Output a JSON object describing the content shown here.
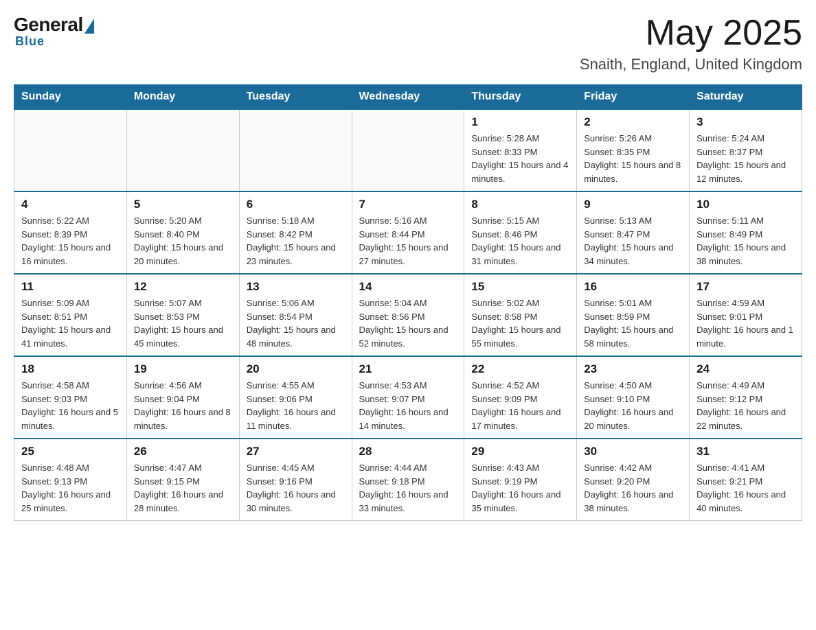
{
  "header": {
    "logo": {
      "general": "General",
      "blue": "Blue"
    },
    "title": "May 2025",
    "subtitle": "Snaith, England, United Kingdom"
  },
  "calendar": {
    "days_of_week": [
      "Sunday",
      "Monday",
      "Tuesday",
      "Wednesday",
      "Thursday",
      "Friday",
      "Saturday"
    ],
    "weeks": [
      [
        {
          "day": "",
          "info": ""
        },
        {
          "day": "",
          "info": ""
        },
        {
          "day": "",
          "info": ""
        },
        {
          "day": "",
          "info": ""
        },
        {
          "day": "1",
          "info": "Sunrise: 5:28 AM\nSunset: 8:33 PM\nDaylight: 15 hours and 4 minutes."
        },
        {
          "day": "2",
          "info": "Sunrise: 5:26 AM\nSunset: 8:35 PM\nDaylight: 15 hours and 8 minutes."
        },
        {
          "day": "3",
          "info": "Sunrise: 5:24 AM\nSunset: 8:37 PM\nDaylight: 15 hours and 12 minutes."
        }
      ],
      [
        {
          "day": "4",
          "info": "Sunrise: 5:22 AM\nSunset: 8:39 PM\nDaylight: 15 hours and 16 minutes."
        },
        {
          "day": "5",
          "info": "Sunrise: 5:20 AM\nSunset: 8:40 PM\nDaylight: 15 hours and 20 minutes."
        },
        {
          "day": "6",
          "info": "Sunrise: 5:18 AM\nSunset: 8:42 PM\nDaylight: 15 hours and 23 minutes."
        },
        {
          "day": "7",
          "info": "Sunrise: 5:16 AM\nSunset: 8:44 PM\nDaylight: 15 hours and 27 minutes."
        },
        {
          "day": "8",
          "info": "Sunrise: 5:15 AM\nSunset: 8:46 PM\nDaylight: 15 hours and 31 minutes."
        },
        {
          "day": "9",
          "info": "Sunrise: 5:13 AM\nSunset: 8:47 PM\nDaylight: 15 hours and 34 minutes."
        },
        {
          "day": "10",
          "info": "Sunrise: 5:11 AM\nSunset: 8:49 PM\nDaylight: 15 hours and 38 minutes."
        }
      ],
      [
        {
          "day": "11",
          "info": "Sunrise: 5:09 AM\nSunset: 8:51 PM\nDaylight: 15 hours and 41 minutes."
        },
        {
          "day": "12",
          "info": "Sunrise: 5:07 AM\nSunset: 8:53 PM\nDaylight: 15 hours and 45 minutes."
        },
        {
          "day": "13",
          "info": "Sunrise: 5:06 AM\nSunset: 8:54 PM\nDaylight: 15 hours and 48 minutes."
        },
        {
          "day": "14",
          "info": "Sunrise: 5:04 AM\nSunset: 8:56 PM\nDaylight: 15 hours and 52 minutes."
        },
        {
          "day": "15",
          "info": "Sunrise: 5:02 AM\nSunset: 8:58 PM\nDaylight: 15 hours and 55 minutes."
        },
        {
          "day": "16",
          "info": "Sunrise: 5:01 AM\nSunset: 8:59 PM\nDaylight: 15 hours and 58 minutes."
        },
        {
          "day": "17",
          "info": "Sunrise: 4:59 AM\nSunset: 9:01 PM\nDaylight: 16 hours and 1 minute."
        }
      ],
      [
        {
          "day": "18",
          "info": "Sunrise: 4:58 AM\nSunset: 9:03 PM\nDaylight: 16 hours and 5 minutes."
        },
        {
          "day": "19",
          "info": "Sunrise: 4:56 AM\nSunset: 9:04 PM\nDaylight: 16 hours and 8 minutes."
        },
        {
          "day": "20",
          "info": "Sunrise: 4:55 AM\nSunset: 9:06 PM\nDaylight: 16 hours and 11 minutes."
        },
        {
          "day": "21",
          "info": "Sunrise: 4:53 AM\nSunset: 9:07 PM\nDaylight: 16 hours and 14 minutes."
        },
        {
          "day": "22",
          "info": "Sunrise: 4:52 AM\nSunset: 9:09 PM\nDaylight: 16 hours and 17 minutes."
        },
        {
          "day": "23",
          "info": "Sunrise: 4:50 AM\nSunset: 9:10 PM\nDaylight: 16 hours and 20 minutes."
        },
        {
          "day": "24",
          "info": "Sunrise: 4:49 AM\nSunset: 9:12 PM\nDaylight: 16 hours and 22 minutes."
        }
      ],
      [
        {
          "day": "25",
          "info": "Sunrise: 4:48 AM\nSunset: 9:13 PM\nDaylight: 16 hours and 25 minutes."
        },
        {
          "day": "26",
          "info": "Sunrise: 4:47 AM\nSunset: 9:15 PM\nDaylight: 16 hours and 28 minutes."
        },
        {
          "day": "27",
          "info": "Sunrise: 4:45 AM\nSunset: 9:16 PM\nDaylight: 16 hours and 30 minutes."
        },
        {
          "day": "28",
          "info": "Sunrise: 4:44 AM\nSunset: 9:18 PM\nDaylight: 16 hours and 33 minutes."
        },
        {
          "day": "29",
          "info": "Sunrise: 4:43 AM\nSunset: 9:19 PM\nDaylight: 16 hours and 35 minutes."
        },
        {
          "day": "30",
          "info": "Sunrise: 4:42 AM\nSunset: 9:20 PM\nDaylight: 16 hours and 38 minutes."
        },
        {
          "day": "31",
          "info": "Sunrise: 4:41 AM\nSunset: 9:21 PM\nDaylight: 16 hours and 40 minutes."
        }
      ]
    ]
  }
}
